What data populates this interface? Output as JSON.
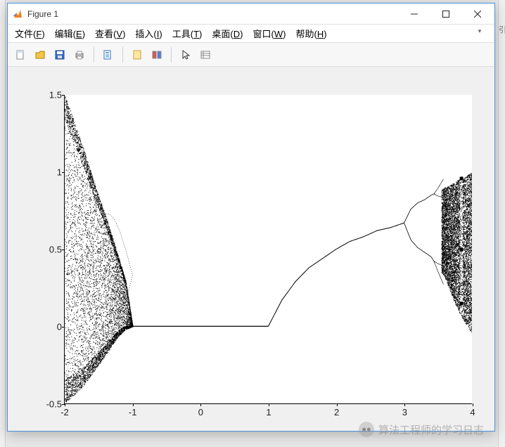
{
  "window": {
    "title": "Figure 1"
  },
  "menubar": {
    "items": [
      {
        "label": "文件",
        "hotkey": "F"
      },
      {
        "label": "编辑",
        "hotkey": "E"
      },
      {
        "label": "查看",
        "hotkey": "V"
      },
      {
        "label": "插入",
        "hotkey": "I"
      },
      {
        "label": "工具",
        "hotkey": "T"
      },
      {
        "label": "桌面",
        "hotkey": "D"
      },
      {
        "label": "窗口",
        "hotkey": "W"
      },
      {
        "label": "帮助",
        "hotkey": "H"
      }
    ]
  },
  "toolbar": {
    "items": [
      "new-file",
      "open-file",
      "save",
      "print",
      "sep",
      "print-preview",
      "sep",
      "zoom-object",
      "colorbar",
      "sep",
      "pointer",
      "data-cursor"
    ]
  },
  "chart_data": {
    "type": "scatter",
    "description": "Bifurcation-style diagram (logistic/tent-like map). For r in [-2,-1] and [3,4] the orbit is chaotic (dense black bands punctuated by period-doubling windows). For r in (-1,1) the orbit is the single fixed point y=0. For r in [1,3] the orbit is a single curve rising from (1,0) toward (3,0.67) roughly following 1 - 1/r. Values below are the upper/lower envelope of the attractor region and the single-branch curve, read off the axes.",
    "x": [
      -2.0,
      -1.9,
      -1.8,
      -1.7,
      -1.6,
      -1.5,
      -1.4,
      -1.3,
      -1.2,
      -1.1,
      -1.0,
      -0.5,
      0.0,
      0.5,
      1.0,
      1.2,
      1.4,
      1.6,
      1.8,
      2.0,
      2.2,
      2.4,
      2.6,
      2.8,
      3.0,
      3.1,
      3.2,
      3.3,
      3.4,
      3.5,
      3.6,
      3.7,
      3.8,
      3.9,
      4.0
    ],
    "envelope_upper": [
      1.5,
      1.38,
      1.25,
      1.12,
      0.98,
      0.85,
      0.72,
      0.58,
      0.44,
      0.29,
      0.0,
      0.0,
      0.0,
      0.0,
      0.0,
      0.17,
      0.29,
      0.38,
      0.44,
      0.5,
      0.55,
      0.58,
      0.62,
      0.64,
      0.67,
      0.76,
      0.8,
      0.82,
      0.85,
      0.87,
      0.9,
      0.92,
      0.95,
      0.97,
      1.0
    ],
    "envelope_lower": [
      -0.5,
      -0.46,
      -0.42,
      -0.37,
      -0.31,
      -0.25,
      -0.19,
      -0.12,
      -0.06,
      -0.02,
      0.0,
      0.0,
      0.0,
      0.0,
      0.0,
      0.17,
      0.29,
      0.38,
      0.44,
      0.5,
      0.55,
      0.58,
      0.62,
      0.64,
      0.67,
      0.56,
      0.51,
      0.48,
      0.45,
      0.38,
      0.32,
      0.2,
      0.1,
      0.02,
      -0.05
    ],
    "xlim": [
      -2,
      4
    ],
    "ylim": [
      -0.5,
      1.5
    ],
    "xticks": [
      -2,
      -1,
      0,
      1,
      2,
      3,
      4
    ],
    "yticks": [
      -0.5,
      0,
      0.5,
      1,
      1.5
    ],
    "xlabel": "",
    "ylabel": "",
    "title": ""
  },
  "watermark": {
    "text": "算法工程师的学习日志"
  }
}
